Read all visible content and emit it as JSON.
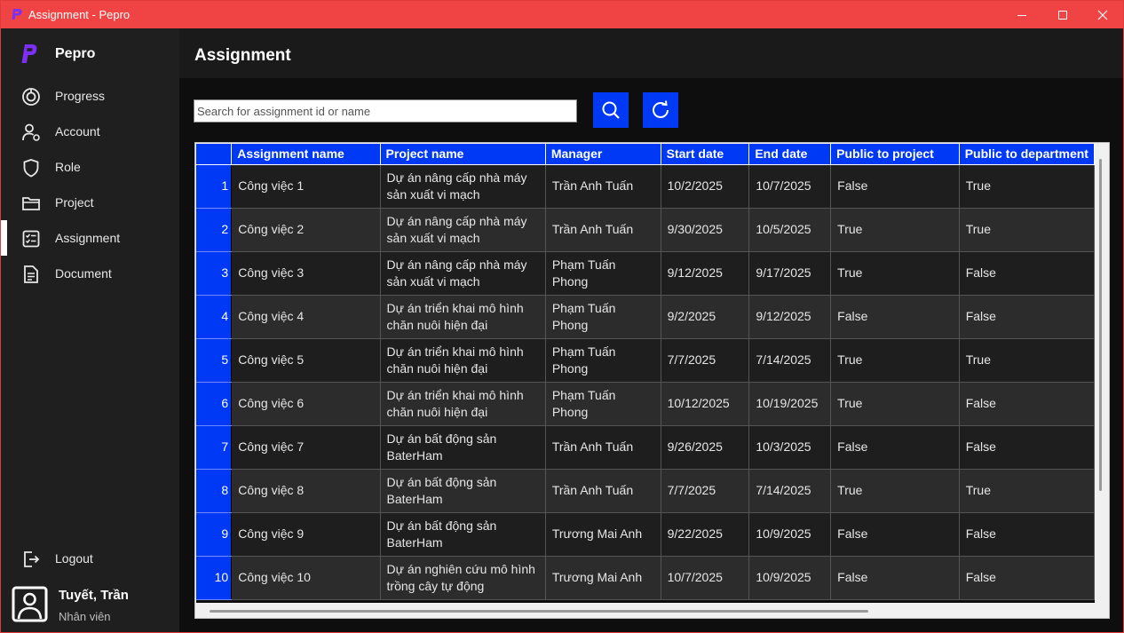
{
  "window": {
    "title": "Assignment - Pepro"
  },
  "sidebar": {
    "brand": "Pepro",
    "items": [
      {
        "label": "Progress",
        "icon": "progress-icon"
      },
      {
        "label": "Account",
        "icon": "account-icon"
      },
      {
        "label": "Role",
        "icon": "shield-icon"
      },
      {
        "label": "Project",
        "icon": "folder-icon"
      },
      {
        "label": "Assignment",
        "icon": "checklist-icon",
        "active": true
      },
      {
        "label": "Document",
        "icon": "document-icon"
      }
    ],
    "logout": "Logout",
    "user": {
      "name": "Tuyết, Trần",
      "role": "Nhân viên"
    }
  },
  "header": {
    "title": "Assignment"
  },
  "search": {
    "placeholder": "Search for assignment id or name"
  },
  "table": {
    "columns": [
      "",
      "Assignment name",
      "Project name",
      "Manager",
      "Start date",
      "End date",
      "Public to project",
      "Public to department"
    ],
    "rows": [
      {
        "num": "1",
        "name": "Công việc 1",
        "project": "Dự án nâng cấp nhà máy sản xuất vi mạch",
        "manager": "Trần Anh Tuấn",
        "start": "10/2/2025",
        "end": "10/7/2025",
        "pub_project": "False",
        "pub_dept": "True"
      },
      {
        "num": "2",
        "name": "Công việc 2",
        "project": "Dự án nâng cấp nhà máy sản xuất vi mạch",
        "manager": "Trần Anh Tuấn",
        "start": "9/30/2025",
        "end": "10/5/2025",
        "pub_project": "True",
        "pub_dept": "True"
      },
      {
        "num": "3",
        "name": "Công việc 3",
        "project": "Dự án nâng cấp nhà máy sản xuất vi mạch",
        "manager": "Phạm Tuấn Phong",
        "start": "9/12/2025",
        "end": "9/17/2025",
        "pub_project": "True",
        "pub_dept": "False"
      },
      {
        "num": "4",
        "name": "Công việc 4",
        "project": "Dự án triển khai mô hình chăn nuôi hiện đại",
        "manager": "Phạm Tuấn Phong",
        "start": "9/2/2025",
        "end": "9/12/2025",
        "pub_project": "False",
        "pub_dept": "False"
      },
      {
        "num": "5",
        "name": "Công việc 5",
        "project": "Dự án triển khai mô hình chăn nuôi hiện đại",
        "manager": "Phạm Tuấn Phong",
        "start": "7/7/2025",
        "end": "7/14/2025",
        "pub_project": "True",
        "pub_dept": "True"
      },
      {
        "num": "6",
        "name": "Công việc 6",
        "project": "Dự án triển khai mô hình chăn nuôi hiện đại",
        "manager": "Phạm Tuấn Phong",
        "start": "10/12/2025",
        "end": "10/19/2025",
        "pub_project": "True",
        "pub_dept": "False"
      },
      {
        "num": "7",
        "name": "Công việc 7",
        "project": "Dự án bất động sản BaterHam",
        "manager": "Trần Anh Tuấn",
        "start": "9/26/2025",
        "end": "10/3/2025",
        "pub_project": "False",
        "pub_dept": "False"
      },
      {
        "num": "8",
        "name": "Công việc 8",
        "project": "Dự án bất động sản BaterHam",
        "manager": "Trần Anh Tuấn",
        "start": "7/7/2025",
        "end": "7/14/2025",
        "pub_project": "True",
        "pub_dept": "True"
      },
      {
        "num": "9",
        "name": "Công việc 9",
        "project": "Dự án bất động sản BaterHam",
        "manager": "Trương Mai Anh",
        "start": "9/22/2025",
        "end": "10/9/2025",
        "pub_project": "False",
        "pub_dept": "False"
      },
      {
        "num": "10",
        "name": "Công việc 10",
        "project": "Dự án nghiên cứu mô hình trồng cây tự động",
        "manager": "Trương Mai Anh",
        "start": "10/7/2025",
        "end": "10/9/2025",
        "pub_project": "False",
        "pub_dept": "False"
      }
    ]
  },
  "colors": {
    "accent": "#0039f5",
    "titlebar": "#f04444",
    "brand_logo": "#7b2ff7"
  }
}
